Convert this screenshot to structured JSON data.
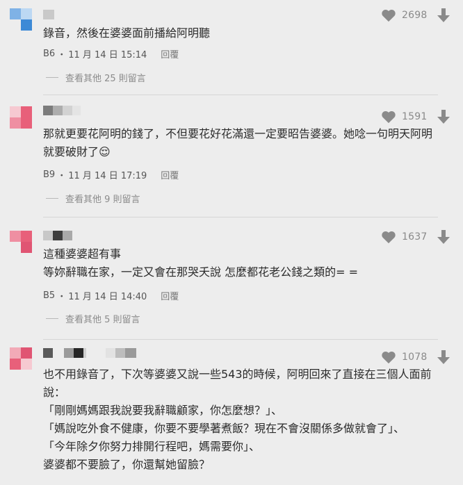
{
  "colors": {
    "blue": "#4a90d9",
    "pink": "#e8607a",
    "gray": "#888888"
  },
  "comments": [
    {
      "floor": "B6",
      "date": "11 月 14 日 15:14",
      "reply_label": "回覆",
      "likes": "2698",
      "lines": [
        "錄音，然後在婆婆面前播給阿明聽"
      ],
      "more": "查看其他 25 則留言"
    },
    {
      "floor": "B9",
      "date": "11 月 14 日 17:19",
      "reply_label": "回覆",
      "likes": "1591",
      "lines": [
        "那就更要花阿明的錢了，不但要花好花滿還一定要昭告婆婆。她唸一句明天阿明",
        "就要破財了😌"
      ],
      "more": "查看其他 9 則留言"
    },
    {
      "floor": "B5",
      "date": "11 月 14 日 14:40",
      "reply_label": "回覆",
      "likes": "1637",
      "lines": [
        "這種婆婆超有事",
        "等妳辭職在家，一定又會在那哭夭說 怎麼都花老公錢之類的= ="
      ],
      "more": "查看其他 5 則留言"
    },
    {
      "likes": "1078",
      "lines": [
        "也不用錄音了，下次等婆婆又說一些543的時候，阿明回來了直接在三個人面前",
        "說：",
        "「剛剛媽媽跟我說要我辭職顧家，你怎麼想？」、",
        "「媽說吃外食不健康，你要不要學著煮飯？現在不會沒關係多做就會了」、",
        "「今年除夕你努力排開行程吧，媽需要你」、",
        "婆婆都不要臉了，你還幫她留臉？"
      ]
    }
  ]
}
